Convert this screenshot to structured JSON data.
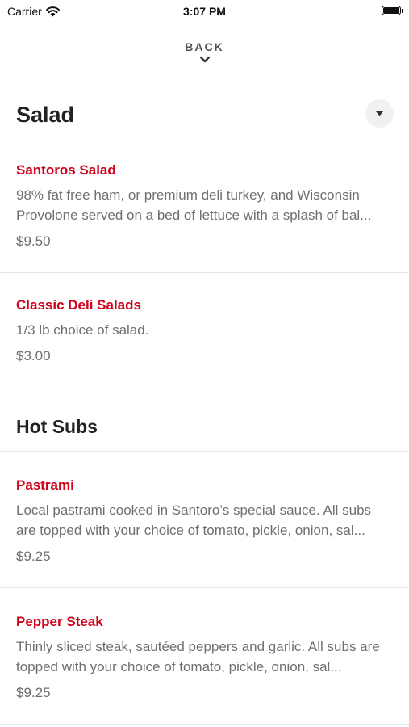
{
  "status_bar": {
    "carrier": "Carrier",
    "time": "3:07 PM"
  },
  "nav": {
    "back_label": "BACK"
  },
  "section": {
    "title": "Salad"
  },
  "salad_items": [
    {
      "name": "Santoros Salad",
      "description": "98% fat free ham, or premium deli turkey, and Wisconsin Provolone served on a bed of lettuce with a splash of bal...",
      "price": "$9.50"
    },
    {
      "name": "Classic Deli Salads",
      "description": "1/3 lb choice of salad.",
      "price": "$3.00"
    }
  ],
  "hot_subs": {
    "title": "Hot Subs",
    "items": [
      {
        "name": "Pastrami",
        "description": "Local pastrami cooked in Santoro’s special sauce. All subs are topped with your choice of tomato, pickle, onion, sal...",
        "price": "$9.25"
      },
      {
        "name": "Pepper Steak",
        "description": "Thinly sliced steak, sautéed peppers and garlic. All subs are topped with your choice of tomato, pickle, onion, sal...",
        "price": "$9.25"
      }
    ]
  },
  "icons": {
    "wifi": "wifi-icon",
    "battery": "battery-icon",
    "chevron": "chevron-down-icon",
    "dropdown": "caret-down-icon"
  },
  "colors": {
    "accent": "#d0021b",
    "text_secondary": "#6f6f6f",
    "divider": "#e6e6e6"
  }
}
